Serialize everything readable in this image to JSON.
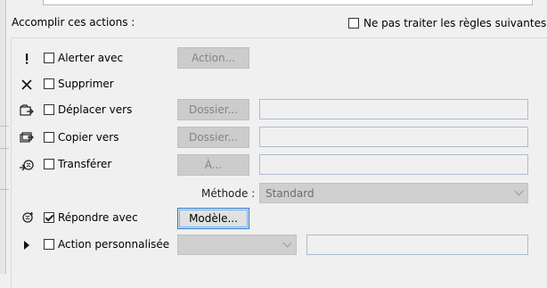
{
  "header": {
    "label": "Accomplir ces actions :",
    "stop_rules_label": "Ne pas traiter les règles suivantes"
  },
  "actions": [
    {
      "icon": "exclamation-icon",
      "label": "Alerter avec",
      "checked": false,
      "button": "Action...",
      "button_enabled": false
    },
    {
      "icon": "delete-x-icon",
      "label": "Supprimer",
      "checked": false
    },
    {
      "icon": "move-to-folder-icon",
      "label": "Déplacer vers",
      "checked": false,
      "button": "Dossier...",
      "button_enabled": false,
      "field_value": ""
    },
    {
      "icon": "copy-to-folder-icon",
      "label": "Copier vers",
      "checked": false,
      "button": "Dossier...",
      "button_enabled": false,
      "field_value": ""
    },
    {
      "icon": "forward-icon",
      "label": "Transférer",
      "checked": false,
      "button": "À...",
      "button_enabled": false,
      "field_value": ""
    },
    {
      "icon": "reply-icon",
      "label": "Répondre avec",
      "checked": true,
      "button": "Modèle...",
      "button_enabled": true
    },
    {
      "icon": "play-arrow-icon",
      "label": "Action personnalisée",
      "checked": false,
      "combo_value": "",
      "field_value": ""
    }
  ],
  "method": {
    "label": "Méthode :",
    "value": "Standard"
  }
}
